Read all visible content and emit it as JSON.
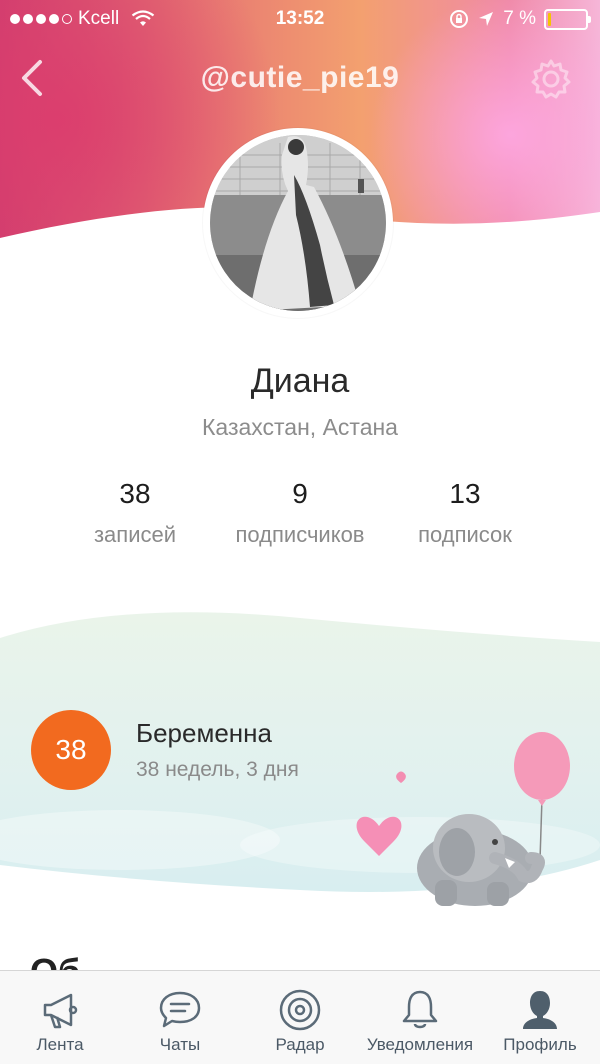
{
  "status_bar": {
    "carrier": "Kcell",
    "time": "13:52",
    "battery_percent": "7 %",
    "battery_level": 0.07,
    "icons": [
      "signal-dots-icon",
      "wifi-icon",
      "rotation-lock-icon",
      "location-arrow-icon",
      "battery-icon"
    ]
  },
  "header": {
    "username": "@cutie_pie19",
    "back_icon": "chevron-left-icon",
    "settings_icon": "gear-icon"
  },
  "profile": {
    "name": "Диана",
    "location": "Казахстан, Астана",
    "stats": [
      {
        "value": "38",
        "label": "записей"
      },
      {
        "value": "9",
        "label": "подписчиков"
      },
      {
        "value": "13",
        "label": "подписок"
      }
    ]
  },
  "pregnancy": {
    "week": "38",
    "title": "Беременна",
    "subtitle": "38 недель, 3 дня"
  },
  "next_section_heading_partial": "Об",
  "tabbar": {
    "items": [
      {
        "label": "Лента",
        "icon": "megaphone-icon"
      },
      {
        "label": "Чаты",
        "icon": "chat-bubble-icon"
      },
      {
        "label": "Радар",
        "icon": "radar-icon"
      },
      {
        "label": "Уведомления",
        "icon": "bell-icon"
      },
      {
        "label": "Профиль",
        "icon": "person-icon"
      }
    ],
    "active_index": 4
  },
  "colors": {
    "accent_orange": "#f26a1f",
    "tab_icon": "#5b6b78",
    "text_gray": "#8a8a8a"
  }
}
